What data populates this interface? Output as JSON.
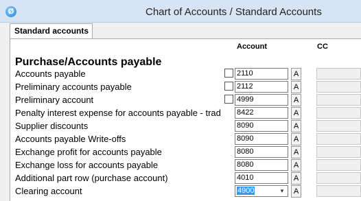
{
  "window": {
    "title": "Chart of Accounts / Standard Accounts"
  },
  "tab": {
    "label": "Standard accounts"
  },
  "columns": {
    "account": "Account",
    "cc": "CC"
  },
  "section": {
    "title": "Purchase/Accounts payable"
  },
  "button_label": "A",
  "rows": [
    {
      "label": "Accounts payable",
      "account": "2110",
      "has_checkbox": true
    },
    {
      "label": "Preliminary accounts payable",
      "account": "2112",
      "has_checkbox": true
    },
    {
      "label": "Preliminary account",
      "account": "4999",
      "has_checkbox": true
    },
    {
      "label": "Penalty interest expense for accounts payable - trad",
      "account": "8422",
      "has_checkbox": false
    },
    {
      "label": "Supplier discounts",
      "account": "8090",
      "has_checkbox": false
    },
    {
      "label": "Accounts payable Write-offs",
      "account": "8090",
      "has_checkbox": false
    },
    {
      "label": "Exchange profit for accounts payable",
      "account": "8080",
      "has_checkbox": false
    },
    {
      "label": "Exchange loss for accounts payable",
      "account": "8080",
      "has_checkbox": false
    },
    {
      "label": "Additional part row (purchase account)",
      "account": "4010",
      "has_checkbox": false
    },
    {
      "label": "Clearing account",
      "account": "4900",
      "has_checkbox": false,
      "dropdown": true,
      "selected": true
    }
  ]
}
